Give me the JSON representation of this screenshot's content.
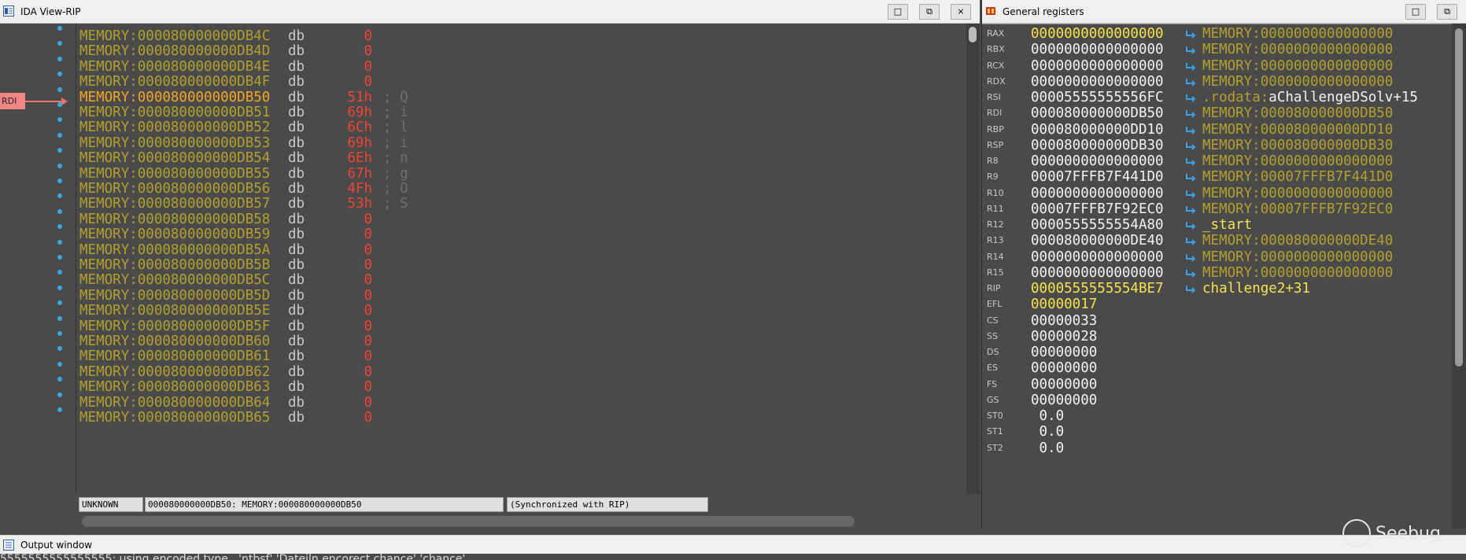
{
  "ida_view": {
    "title": "IDA View-RIP",
    "buttons": [
      "□",
      "⧉",
      "×"
    ],
    "pointer_label": "RDI",
    "current_row": 4,
    "rows": [
      {
        "addr": "MEMORY:000080000000DB4C",
        "op": "db",
        "val": "0",
        "cmt": ""
      },
      {
        "addr": "MEMORY:000080000000DB4D",
        "op": "db",
        "val": "0",
        "cmt": ""
      },
      {
        "addr": "MEMORY:000080000000DB4E",
        "op": "db",
        "val": "0",
        "cmt": ""
      },
      {
        "addr": "MEMORY:000080000000DB4F",
        "op": "db",
        "val": "0",
        "cmt": ""
      },
      {
        "addr": "MEMORY:000080000000DB50",
        "op": "db",
        "val": "51h",
        "cmt": "; Q"
      },
      {
        "addr": "MEMORY:000080000000DB51",
        "op": "db",
        "val": "69h",
        "cmt": "; i"
      },
      {
        "addr": "MEMORY:000080000000DB52",
        "op": "db",
        "val": "6Ch",
        "cmt": "; l"
      },
      {
        "addr": "MEMORY:000080000000DB53",
        "op": "db",
        "val": "69h",
        "cmt": "; i"
      },
      {
        "addr": "MEMORY:000080000000DB54",
        "op": "db",
        "val": "6Eh",
        "cmt": "; n"
      },
      {
        "addr": "MEMORY:000080000000DB55",
        "op": "db",
        "val": "67h",
        "cmt": "; g"
      },
      {
        "addr": "MEMORY:000080000000DB56",
        "op": "db",
        "val": "4Fh",
        "cmt": "; O"
      },
      {
        "addr": "MEMORY:000080000000DB57",
        "op": "db",
        "val": "53h",
        "cmt": "; S"
      },
      {
        "addr": "MEMORY:000080000000DB58",
        "op": "db",
        "val": "0",
        "cmt": ""
      },
      {
        "addr": "MEMORY:000080000000DB59",
        "op": "db",
        "val": "0",
        "cmt": ""
      },
      {
        "addr": "MEMORY:000080000000DB5A",
        "op": "db",
        "val": "0",
        "cmt": ""
      },
      {
        "addr": "MEMORY:000080000000DB5B",
        "op": "db",
        "val": "0",
        "cmt": ""
      },
      {
        "addr": "MEMORY:000080000000DB5C",
        "op": "db",
        "val": "0",
        "cmt": ""
      },
      {
        "addr": "MEMORY:000080000000DB5D",
        "op": "db",
        "val": "0",
        "cmt": ""
      },
      {
        "addr": "MEMORY:000080000000DB5E",
        "op": "db",
        "val": "0",
        "cmt": ""
      },
      {
        "addr": "MEMORY:000080000000DB5F",
        "op": "db",
        "val": "0",
        "cmt": ""
      },
      {
        "addr": "MEMORY:000080000000DB60",
        "op": "db",
        "val": "0",
        "cmt": ""
      },
      {
        "addr": "MEMORY:000080000000DB61",
        "op": "db",
        "val": "0",
        "cmt": ""
      },
      {
        "addr": "MEMORY:000080000000DB62",
        "op": "db",
        "val": "0",
        "cmt": ""
      },
      {
        "addr": "MEMORY:000080000000DB63",
        "op": "db",
        "val": "0",
        "cmt": ""
      },
      {
        "addr": "MEMORY:000080000000DB64",
        "op": "db",
        "val": "0",
        "cmt": ""
      },
      {
        "addr": "MEMORY:000080000000DB65",
        "op": "db",
        "val": "0",
        "cmt": ""
      }
    ],
    "status": {
      "segment": "UNKNOWN",
      "location": "000080000000DB50: MEMORY:000080000000DB50",
      "sync": "(Synchronized with RIP)"
    }
  },
  "registers": {
    "title": "General registers",
    "buttons": [
      "□",
      "⧉"
    ],
    "rows": [
      {
        "name": "RAX",
        "value": "0000000000000000",
        "desc": "MEMORY:0000000000000000",
        "changed": true,
        "kind": "mem"
      },
      {
        "name": "RBX",
        "value": "0000000000000000",
        "desc": "MEMORY:0000000000000000",
        "changed": false,
        "kind": "mem"
      },
      {
        "name": "RCX",
        "value": "0000000000000000",
        "desc": "MEMORY:0000000000000000",
        "changed": false,
        "kind": "mem"
      },
      {
        "name": "RDX",
        "value": "0000000000000000",
        "desc": "MEMORY:0000000000000000",
        "changed": false,
        "kind": "mem"
      },
      {
        "name": "RSI",
        "value": "00005555555556FC",
        "desc_prefix": ".rodata:",
        "desc": "aChallengeDSolv+15",
        "changed": false,
        "kind": "rodata"
      },
      {
        "name": "RDI",
        "value": "000080000000DB50",
        "desc": "MEMORY:000080000000DB50",
        "changed": false,
        "kind": "mem"
      },
      {
        "name": "RBP",
        "value": "000080000000DD10",
        "desc": "MEMORY:000080000000DD10",
        "changed": false,
        "kind": "mem"
      },
      {
        "name": "RSP",
        "value": "000080000000DB30",
        "desc": "MEMORY:000080000000DB30",
        "changed": false,
        "kind": "mem"
      },
      {
        "name": "R8",
        "value": "0000000000000000",
        "desc": "MEMORY:0000000000000000",
        "changed": false,
        "kind": "mem"
      },
      {
        "name": "R9",
        "value": "00007FFFB7F441D0",
        "desc": "MEMORY:00007FFFB7F441D0",
        "changed": false,
        "kind": "mem"
      },
      {
        "name": "R10",
        "value": "0000000000000000",
        "desc": "MEMORY:0000000000000000",
        "changed": false,
        "kind": "mem"
      },
      {
        "name": "R11",
        "value": "00007FFFB7F92EC0",
        "desc": "MEMORY:00007FFFB7F92EC0",
        "changed": false,
        "kind": "mem"
      },
      {
        "name": "R12",
        "value": "0000555555554A80",
        "desc": "_start",
        "changed": false,
        "kind": "code"
      },
      {
        "name": "R13",
        "value": "000080000000DE40",
        "desc": "MEMORY:000080000000DE40",
        "changed": false,
        "kind": "mem"
      },
      {
        "name": "R14",
        "value": "0000000000000000",
        "desc": "MEMORY:0000000000000000",
        "changed": false,
        "kind": "mem"
      },
      {
        "name": "R15",
        "value": "0000000000000000",
        "desc": "MEMORY:0000000000000000",
        "changed": false,
        "kind": "mem"
      },
      {
        "name": "RIP",
        "value": "0000555555554BE7",
        "desc": "challenge2+31",
        "changed": true,
        "kind": "code"
      },
      {
        "name": "EFL",
        "value": "00000017",
        "changed": true,
        "kind": "none"
      },
      {
        "name": "CS",
        "value": "00000033",
        "changed": false,
        "kind": "none"
      },
      {
        "name": "SS",
        "value": "00000028",
        "changed": false,
        "kind": "none"
      },
      {
        "name": "DS",
        "value": "00000000",
        "changed": false,
        "kind": "none"
      },
      {
        "name": "ES",
        "value": "00000000",
        "changed": false,
        "kind": "none"
      },
      {
        "name": "FS",
        "value": "00000000",
        "changed": false,
        "kind": "none"
      },
      {
        "name": "GS",
        "value": "00000000",
        "changed": false,
        "kind": "none"
      },
      {
        "name": "ST0",
        "value": " 0.0",
        "changed": false,
        "kind": "none"
      },
      {
        "name": "ST1",
        "value": " 0.0",
        "changed": false,
        "kind": "none"
      },
      {
        "name": "ST2",
        "value": " 0.0",
        "changed": false,
        "kind": "none"
      }
    ]
  },
  "output_window": {
    "title": "Output window",
    "text": "5555555555555555: using encoded type   'ntbsf' 'Dateiln encorect chance' 'chance'"
  },
  "watermark": "Seebug",
  "colors": {
    "background": "#4a4a4a",
    "address": "#b2a02e",
    "current_address": "#f5a623",
    "value": "#ee4433",
    "changed_register": "#f5e34a",
    "pointer_tag": "#f08585",
    "breakpoint_dot": "#37a7e0"
  }
}
